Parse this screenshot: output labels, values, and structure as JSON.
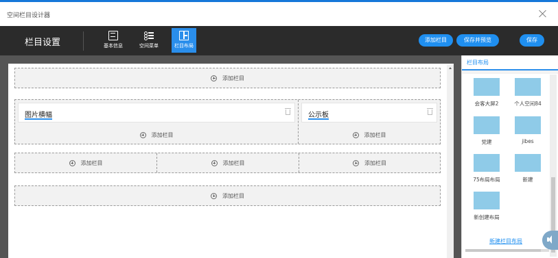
{
  "window": {
    "title": "空间栏目设计器"
  },
  "toolbar": {
    "heading": "栏目设置",
    "tools": [
      {
        "label": "基本信息",
        "icon": "document-icon"
      },
      {
        "label": "空间菜单",
        "icon": "list-icon"
      },
      {
        "label": "栏目布局",
        "icon": "layout-icon",
        "active": true
      }
    ],
    "add_column_label": "添加栏目",
    "save_preview_label": "保存并预览",
    "save_label": "保存"
  },
  "canvas": {
    "add_column_text": "添加栏目",
    "cards": [
      {
        "title": "图片横幅"
      },
      {
        "title": "公示板"
      }
    ]
  },
  "sidebar": {
    "title": "栏目布局",
    "layouts": [
      {
        "name": "会客大屏2"
      },
      {
        "name": "个人空间84"
      },
      {
        "name": "党建"
      },
      {
        "name": "jibes"
      },
      {
        "name": "75布局布局"
      },
      {
        "name": "新建"
      },
      {
        "name": "新创建布局"
      }
    ],
    "new_layout_link": "新建栏目布局"
  },
  "colors": {
    "accent": "#1f8ff0",
    "toolbar_bg": "#2b2b2b",
    "canvas_bg": "#555555",
    "thumb": "#8fcbe8"
  }
}
